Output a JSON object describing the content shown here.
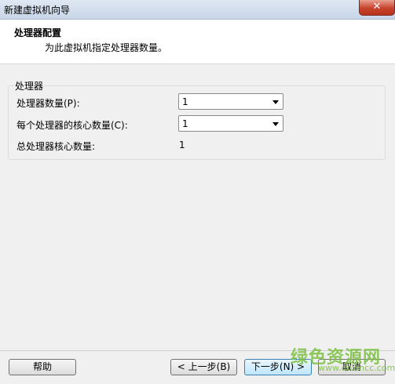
{
  "window": {
    "title": "新建虚拟机向导",
    "close_glyph": "✕"
  },
  "header": {
    "title": "处理器配置",
    "subtitle": "为此虚拟机指定处理器数量。"
  },
  "processor_group": {
    "legend": "处理器",
    "num_processors_label": "处理器数量(P):",
    "num_processors_value": "1",
    "cores_per_processor_label": "每个处理器的核心数量(C):",
    "cores_per_processor_value": "1",
    "total_cores_label": "总处理器核心数量:",
    "total_cores_value": "1"
  },
  "footer": {
    "help_label": "帮助",
    "back_label": "< 上一步(B)",
    "next_label": "下一步(N) >",
    "cancel_label": "取消"
  },
  "watermark": {
    "text": "绿色资源网",
    "url": "www.downcc.com"
  }
}
